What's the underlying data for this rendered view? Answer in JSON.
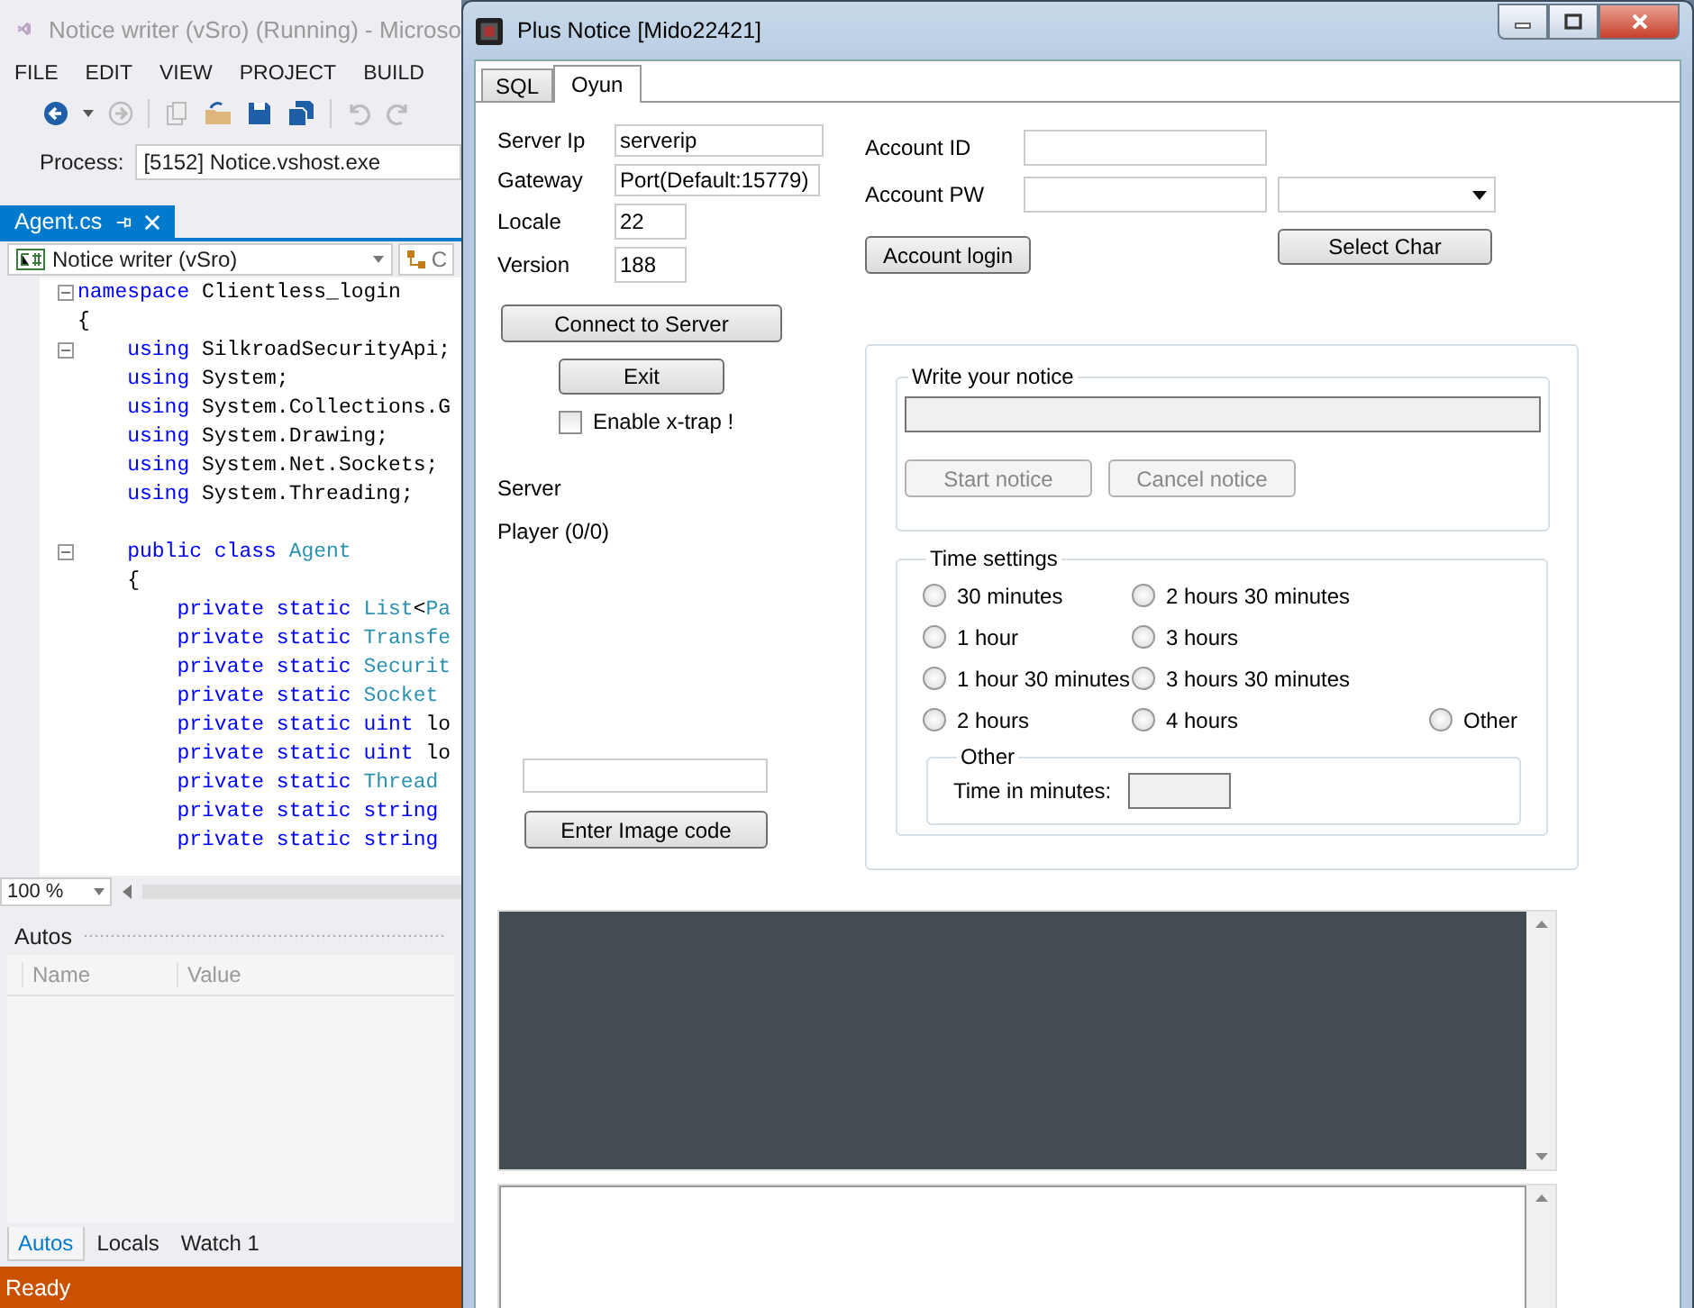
{
  "ide": {
    "title": "Notice writer (vSro) (Running) - Microso",
    "menu": [
      "FILE",
      "EDIT",
      "VIEW",
      "PROJECT",
      "BUILD"
    ],
    "process_label": "Process:",
    "process": "[5152] Notice.vshost.exe",
    "document_tab": "Agent.cs",
    "type_dropdown": "Notice writer (vSro)",
    "member_dropdown": "C",
    "code_lines": [
      {
        "collapsible": true,
        "tokens": [
          {
            "kind": "keyword",
            "text": "namespace"
          },
          {
            "kind": "plain",
            "text": " Clientless_login"
          }
        ]
      },
      {
        "collapsible": false,
        "tokens": [
          {
            "kind": "plain",
            "text": "{"
          }
        ]
      },
      {
        "collapsible": true,
        "tokens": [
          {
            "kind": "keyword",
            "text": "    using"
          },
          {
            "kind": "plain",
            "text": " SilkroadSecurityApi;"
          }
        ]
      },
      {
        "collapsible": false,
        "tokens": [
          {
            "kind": "keyword",
            "text": "    using"
          },
          {
            "kind": "plain",
            "text": " System;"
          }
        ]
      },
      {
        "collapsible": false,
        "tokens": [
          {
            "kind": "keyword",
            "text": "    using"
          },
          {
            "kind": "plain",
            "text": " System.Collections.G"
          }
        ]
      },
      {
        "collapsible": false,
        "tokens": [
          {
            "kind": "keyword",
            "text": "    using"
          },
          {
            "kind": "plain",
            "text": " System.Drawing;"
          }
        ]
      },
      {
        "collapsible": false,
        "tokens": [
          {
            "kind": "keyword",
            "text": "    using"
          },
          {
            "kind": "plain",
            "text": " System.Net.Sockets;"
          }
        ]
      },
      {
        "collapsible": false,
        "tokens": [
          {
            "kind": "keyword",
            "text": "    using"
          },
          {
            "kind": "plain",
            "text": " System.Threading;"
          }
        ]
      },
      {
        "kind": "blank"
      },
      {
        "collapsible": true,
        "tokens": [
          {
            "kind": "keyword",
            "text": "    public class"
          },
          {
            "kind": "type",
            "text": " Agent"
          }
        ]
      },
      {
        "collapsible": false,
        "tokens": [
          {
            "kind": "plain",
            "text": "    {"
          }
        ]
      },
      {
        "collapsible": false,
        "tokens": [
          {
            "kind": "keyword",
            "text": "        private static"
          },
          {
            "kind": "type",
            "text": " List"
          },
          {
            "kind": "plain",
            "text": "<"
          },
          {
            "kind": "type",
            "text": "Pa"
          }
        ]
      },
      {
        "collapsible": false,
        "tokens": [
          {
            "kind": "keyword",
            "text": "        private static"
          },
          {
            "kind": "type",
            "text": " Transfe"
          }
        ]
      },
      {
        "collapsible": false,
        "tokens": [
          {
            "kind": "keyword",
            "text": "        private static"
          },
          {
            "kind": "type",
            "text": " Securit"
          }
        ]
      },
      {
        "collapsible": false,
        "tokens": [
          {
            "kind": "keyword",
            "text": "        private static"
          },
          {
            "kind": "type",
            "text": " Socket"
          }
        ]
      },
      {
        "collapsible": false,
        "tokens": [
          {
            "kind": "keyword",
            "text": "        private static uint"
          },
          {
            "kind": "plain",
            "text": " lo"
          }
        ]
      },
      {
        "collapsible": false,
        "tokens": [
          {
            "kind": "keyword",
            "text": "        private static uint"
          },
          {
            "kind": "plain",
            "text": " lo"
          }
        ]
      },
      {
        "collapsible": false,
        "tokens": [
          {
            "kind": "keyword",
            "text": "        private static"
          },
          {
            "kind": "type",
            "text": " Thread"
          }
        ]
      },
      {
        "collapsible": false,
        "tokens": [
          {
            "kind": "keyword",
            "text": "        private static string"
          }
        ]
      },
      {
        "collapsible": false,
        "tokens": [
          {
            "kind": "keyword",
            "text": "        private static string"
          }
        ]
      }
    ],
    "zoom": "100 %",
    "autos": {
      "title": "Autos",
      "columns": [
        "Name",
        "Value"
      ]
    },
    "bottom_tabs": [
      {
        "label": "Autos",
        "selected": true
      },
      {
        "label": "Locals",
        "selected": false
      },
      {
        "label": "Watch 1",
        "selected": false
      }
    ],
    "status": "Ready"
  },
  "app": {
    "title": "Plus Notice [Mido22421]",
    "tabs": [
      {
        "label": "SQL",
        "selected": false
      },
      {
        "label": "Oyun",
        "selected": true
      }
    ],
    "server_fields": [
      {
        "label": "Server Ip",
        "value": "serverip",
        "kind": "wide"
      },
      {
        "label": "Gateway",
        "value": "Port(Default:15779)",
        "kind": "wide"
      },
      {
        "label": "Locale",
        "value": "22",
        "kind": "short"
      },
      {
        "label": "Version",
        "value": "188",
        "kind": "short"
      }
    ],
    "connect_button": "Connect to Server",
    "exit_button": "Exit",
    "xtrap": {
      "label": "Enable x-trap !",
      "checked": false
    },
    "server_label": "Server",
    "player_label": "Player (0/0)",
    "image_code_button": "Enter Image code",
    "account_id_label": "Account ID",
    "account_pw_label": "Account PW",
    "account_login_button": "Account login",
    "select_char_button": "Select Char",
    "notice_group": {
      "title": "Write your notice",
      "disabled": true,
      "start_button": "Start notice",
      "cancel_button": "Cancel notice"
    },
    "time_group": {
      "title": "Time settings",
      "rows": [
        [
          {
            "label": "30 minutes",
            "selected": false
          },
          {
            "label": "2 hours 30 minutes",
            "selected": false
          }
        ],
        [
          {
            "label": "1 hour",
            "selected": false
          },
          {
            "label": "3 hours",
            "selected": false
          }
        ],
        [
          {
            "label": "1 hour 30 minutes",
            "selected": false
          },
          {
            "label": "3 hours 30 minutes",
            "selected": false
          }
        ],
        [
          {
            "label": "2 hours",
            "selected": false
          },
          {
            "label": "4 hours",
            "selected": false
          },
          {
            "label": "Other",
            "selected": false
          }
        ]
      ]
    },
    "other_group": {
      "title": "Other",
      "label": "Time in minutes:"
    }
  }
}
